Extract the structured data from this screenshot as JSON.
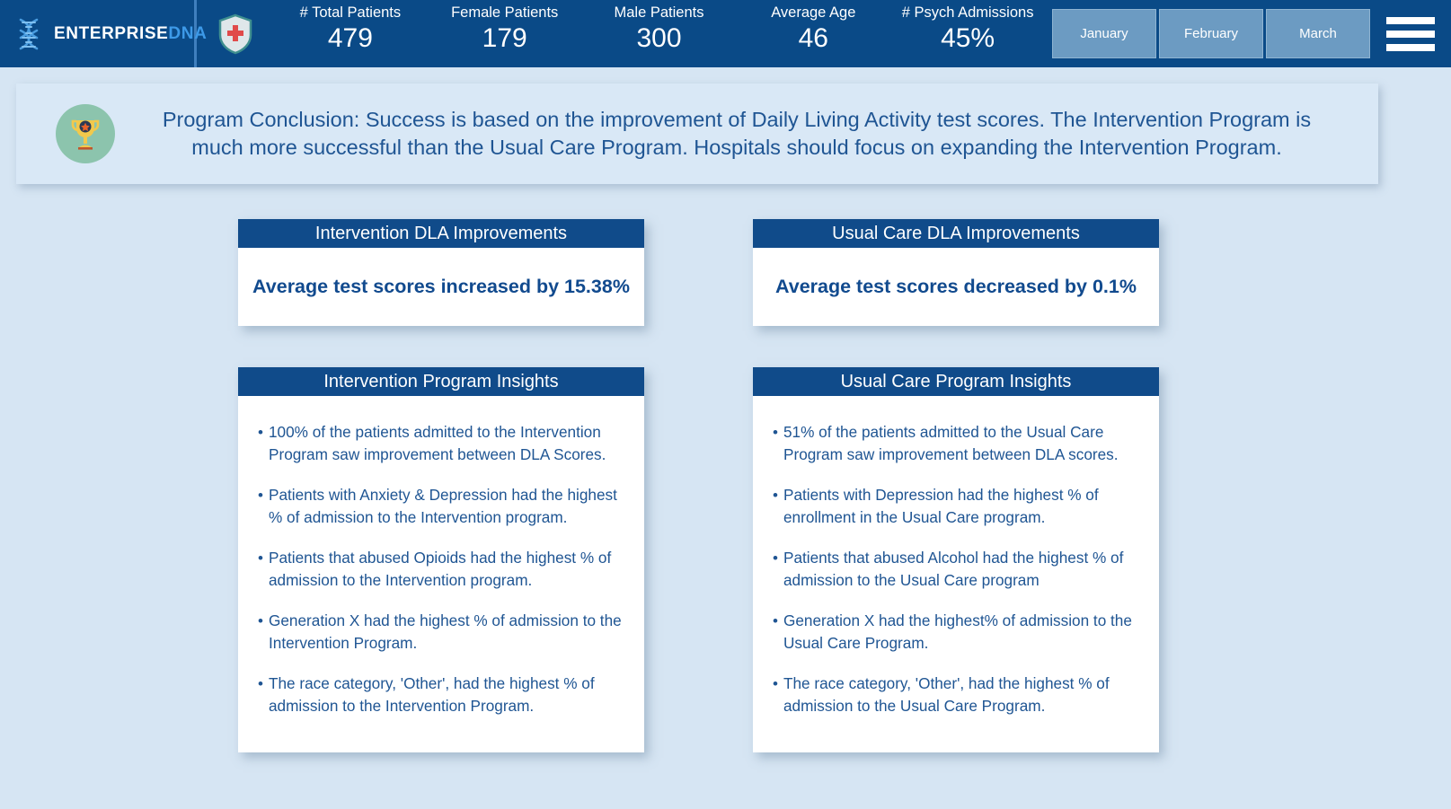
{
  "header": {
    "brand": {
      "name_primary": "ENTERPRISE",
      "name_secondary": "DNA",
      "logo_icon": "dna-helix-icon"
    },
    "shield_icon": "medical-shield-icon",
    "kpis": [
      {
        "label": "# Total Patients",
        "value": "479"
      },
      {
        "label": "Female Patients",
        "value": "179"
      },
      {
        "label": "Male Patients",
        "value": "300"
      },
      {
        "label": "Average Age",
        "value": "46"
      },
      {
        "label": "# Psych Admissions",
        "value": "45%"
      }
    ],
    "month_filters": [
      {
        "label": "January"
      },
      {
        "label": "February"
      },
      {
        "label": "March"
      }
    ],
    "menu_icon": "hamburger-menu-icon"
  },
  "conclusion": {
    "icon": "trophy-icon",
    "text": "Program Conclusion: Success is based on the improvement of Daily Living Activity test scores. The Intervention Program is much more successful than the Usual Care Program. Hospitals should focus on expanding the Intervention Program."
  },
  "cards": {
    "intervention_dla": {
      "title": "Intervention DLA Improvements",
      "summary": "Average test scores increased by 15.38%"
    },
    "usual_dla": {
      "title": "Usual Care DLA Improvements",
      "summary": "Average test scores decreased by 0.1%"
    },
    "intervention_insights": {
      "title": "Intervention Program Insights",
      "bullets": [
        "100% of the patients admitted to the Intervention Program saw improvement between DLA Scores.",
        "Patients with Anxiety & Depression had the highest % of admission to the Intervention program.",
        "Patients that abused Opioids had the highest % of admission to the Intervention program.",
        "Generation X had the highest % of admission to the Intervention Program.",
        "The race category, 'Other', had the highest % of admission to the Intervention Program."
      ]
    },
    "usual_insights": {
      "title": "Usual Care Program Insights",
      "bullets": [
        "51% of the patients admitted to the Usual Care Program saw improvement between DLA scores.",
        "Patients with Depression had the highest % of enrollment in the Usual Care program.",
        "Patients that abused Alcohol had the highest % of admission to the Usual Care program",
        "Generation X had the highest% of admission to the Usual Care Program.",
        "The race category, 'Other', had the highest % of admission to the Usual Care Program."
      ]
    }
  },
  "colors": {
    "header_navy": "#0a4a87",
    "card_header_navy": "#104b8a",
    "page_background": "#d6e5f3",
    "accent_text_blue": "#1f5593",
    "month_button": "#6c9bc2",
    "trophy_circle_green": "#8cc4ad",
    "cross_red": "#e04a4a"
  }
}
